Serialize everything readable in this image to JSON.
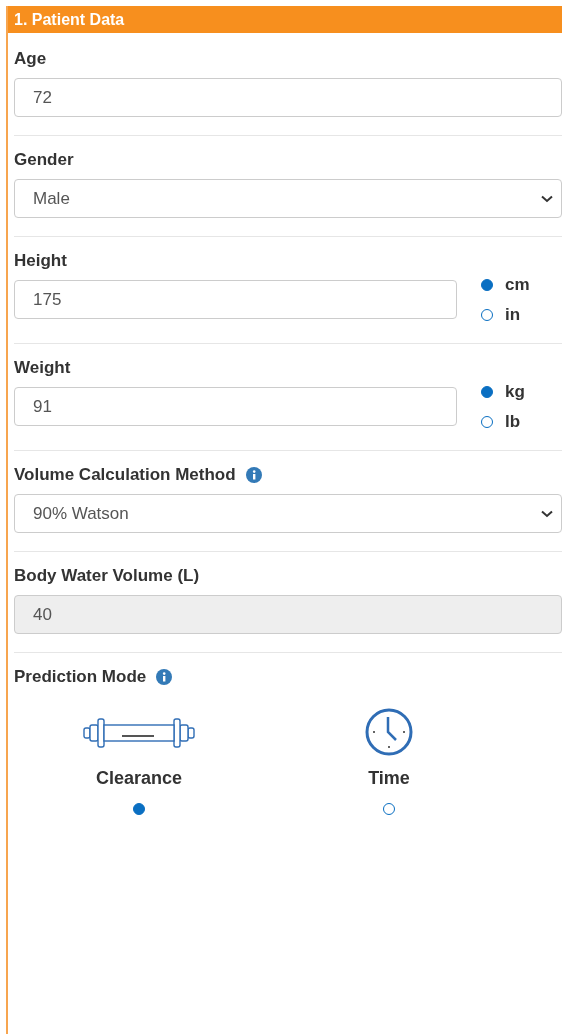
{
  "panel": {
    "title": "1. Patient Data"
  },
  "fields": [
    {
      "kind": "input",
      "label": "Age",
      "value": "72"
    },
    {
      "kind": "select",
      "label": "Gender",
      "value": "Male"
    },
    {
      "kind": "unit",
      "label": "Height",
      "value": "175",
      "units": [
        {
          "label": "cm",
          "selected": true
        },
        {
          "label": "in",
          "selected": false
        }
      ]
    },
    {
      "kind": "unit",
      "label": "Weight",
      "value": "91",
      "units": [
        {
          "label": "kg",
          "selected": true
        },
        {
          "label": "lb",
          "selected": false
        }
      ]
    },
    {
      "kind": "select",
      "label": "Volume Calculation Method",
      "info": true,
      "value": "90% Watson"
    },
    {
      "kind": "readonly",
      "label": "Body Water Volume (L)",
      "value": "40"
    },
    {
      "kind": "modes",
      "label": "Prediction Mode",
      "info": true,
      "options": [
        {
          "label": "Clearance",
          "kind": "dialyzer",
          "selected": true
        },
        {
          "label": "Time",
          "kind": "clock",
          "selected": false
        }
      ]
    }
  ]
}
